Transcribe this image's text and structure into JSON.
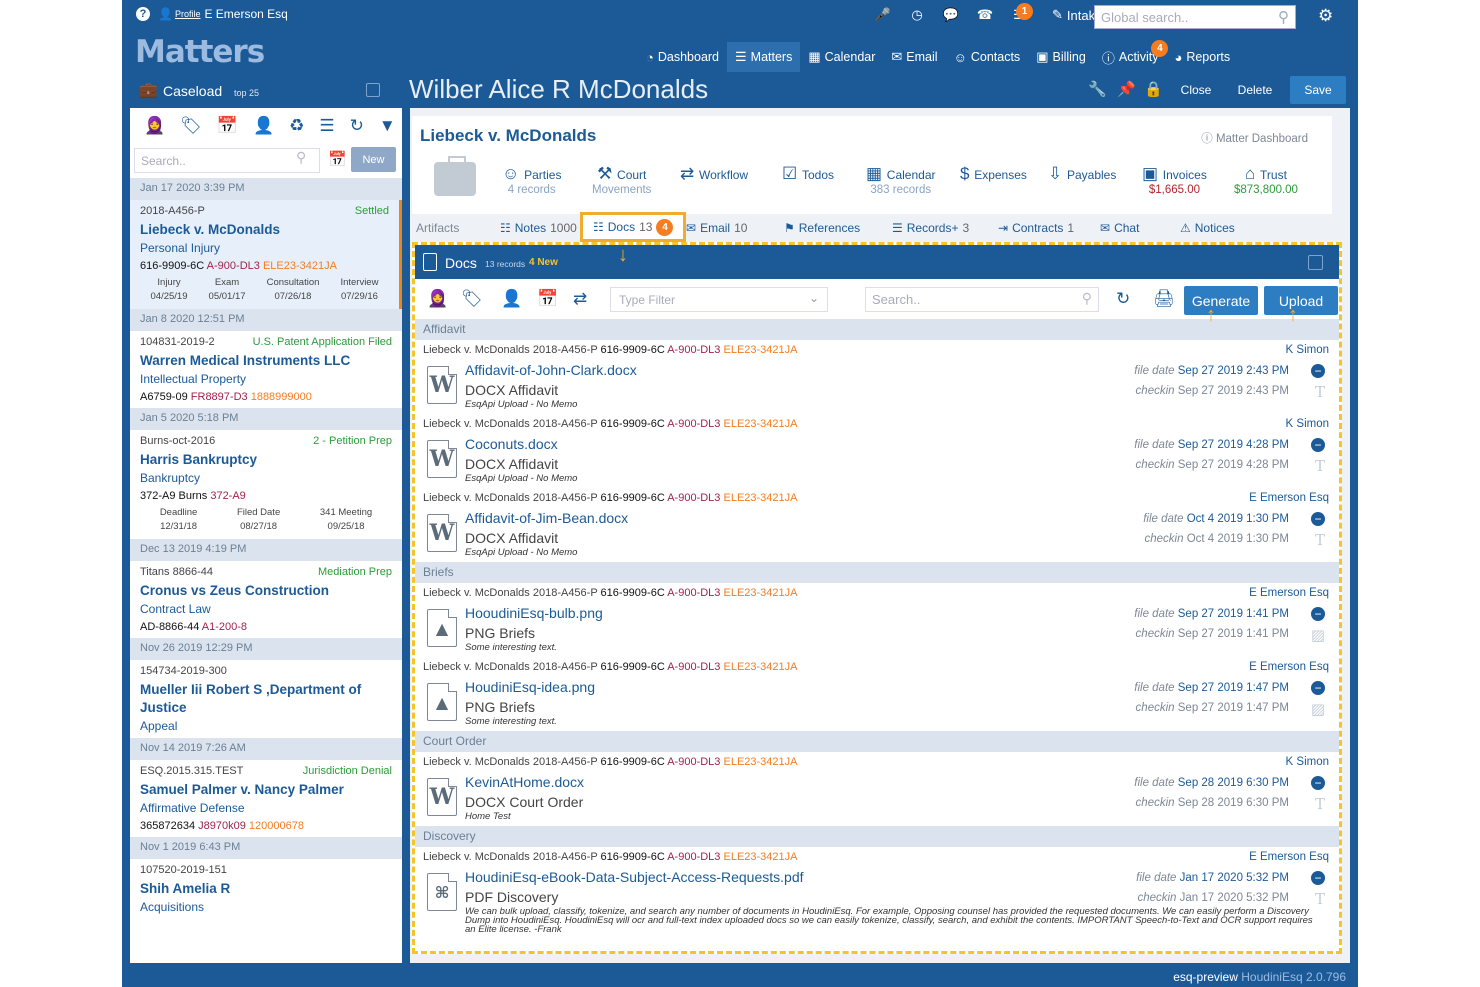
{
  "topbar": {
    "help": "?",
    "profile_label": "Profile",
    "user": "E Emerson Esq",
    "intake": "Intake",
    "search_placeholder": "Global search..",
    "notif_badge": "1"
  },
  "logo": "Matters",
  "nav": [
    {
      "label": "Dashboard",
      "icon": "dashboard-icon"
    },
    {
      "label": "Matters",
      "icon": "matters-icon"
    },
    {
      "label": "Calendar",
      "icon": "calendar-icon"
    },
    {
      "label": "Email",
      "icon": "email-icon"
    },
    {
      "label": "Contacts",
      "icon": "contacts-icon"
    },
    {
      "label": "Billing",
      "icon": "billing-icon"
    },
    {
      "label": "Activity",
      "icon": "activity-icon",
      "badge": "4"
    },
    {
      "label": "Reports",
      "icon": "reports-icon"
    }
  ],
  "caseload": {
    "title": "Caseload",
    "top": "top 25",
    "search_placeholder": "Search..",
    "new": "New"
  },
  "matter_title": "Wilber Alice R McDonalds",
  "actions": {
    "close": "Close",
    "delete": "Delete",
    "save": "Save"
  },
  "cases": [
    {
      "day": "Jan 17 2020 3:39 PM",
      "id": "2018-A456-P",
      "status": "Settled",
      "name": "Liebeck v. McDonalds",
      "type": "Personal Injury",
      "ids": [
        "616-9909-6C",
        "A-900-DL3",
        "ELE23-3421JA"
      ],
      "dates": [
        {
          "l": "Injury",
          "v": "04/25/19"
        },
        {
          "l": "Exam",
          "v": "05/01/17"
        },
        {
          "l": "Consultation",
          "v": "07/26/18"
        },
        {
          "l": "Interview",
          "v": "07/29/16"
        }
      ]
    },
    {
      "day": "Jan 8 2020 12:51 PM",
      "id": "104831-2019-2",
      "status": "U.S. Patent Application Filed",
      "name": "Warren Medical Instruments LLC",
      "type": "Intellectual Property",
      "ids": [
        "A6759-09",
        "FR8897-D3",
        "1888999000"
      ]
    },
    {
      "day": "Jan 5 2020 5:18 PM",
      "id": "Burns-oct-2016",
      "status": "2 - Petition Prep",
      "name": "Harris Bankruptcy",
      "type": "Bankruptcy",
      "ids": [
        "372-A9 Burns",
        "372-A9",
        ""
      ],
      "dates": [
        {
          "l": "Deadline",
          "v": "12/31/18"
        },
        {
          "l": "Filed Date",
          "v": "08/27/18"
        },
        {
          "l": "341 Meeting",
          "v": "09/25/18"
        }
      ]
    },
    {
      "day": "Dec 13 2019 4:19 PM",
      "id": "Titans 8866-44",
      "status": "Mediation Prep",
      "name": "Cronus vs Zeus Construction",
      "type": "Contract Law",
      "ids": [
        "AD-8866-44",
        "A1-200-8",
        ""
      ]
    },
    {
      "day": "Nov 26 2019 12:29 PM",
      "id": "154734-2019-300",
      "status": "",
      "name": "Mueller Iii Robert S ,Department of Justice",
      "type": "Appeal",
      "ids": [
        "",
        "",
        ""
      ]
    },
    {
      "day": "Nov 14 2019 7:26 AM",
      "id": "ESQ.2015.315.TEST",
      "status": "Jurisdiction Denial",
      "name": "Samuel Palmer v. Nancy Palmer",
      "type": "Affirmative Defense",
      "ids": [
        "365872634",
        "J8970k09",
        "120000678"
      ]
    },
    {
      "day": "Nov 1 2019 6:43 PM",
      "id": "107520-2019-151",
      "status": "",
      "name": "Shih Amelia R",
      "type": "Acquisitions",
      "ids": [
        "",
        "",
        ""
      ]
    }
  ],
  "matter": {
    "title": "Liebeck v. McDonalds",
    "dashboard": "Matter Dashboard",
    "items": [
      {
        "label": "Parties",
        "sub": "4 records"
      },
      {
        "label": "Court",
        "sub": "Movements"
      },
      {
        "label": "Workflow",
        "sub": ""
      },
      {
        "label": "Todos",
        "sub": ""
      },
      {
        "label": "Calendar",
        "sub": "383 records"
      },
      {
        "label": "Expenses",
        "sub": ""
      },
      {
        "label": "Payables",
        "sub": ""
      },
      {
        "label": "Invoices",
        "sub": "$1,665.00"
      },
      {
        "label": "Trust",
        "sub": "$873,800.00"
      }
    ]
  },
  "tabs": [
    {
      "label": "Artifacts",
      "count": ""
    },
    {
      "label": "Notes",
      "count": "1000"
    },
    {
      "label": "Docs",
      "count": "13",
      "badge": "4"
    },
    {
      "label": "Email",
      "count": "10"
    },
    {
      "label": "References",
      "count": ""
    },
    {
      "label": "Records+",
      "count": "3"
    },
    {
      "label": "Contracts",
      "count": "1"
    },
    {
      "label": "Chat",
      "count": ""
    },
    {
      "label": "Notices",
      "count": ""
    }
  ],
  "docs": {
    "title": "Docs",
    "count": "13 records",
    "new": "4 New",
    "type_filter": "Type Filter",
    "search_placeholder": "Search..",
    "generate": "Generate",
    "upload": "Upload",
    "groups": [
      {
        "name": "Affidavit",
        "items": [
          {
            "ref": [
              "Liebeck v. McDonalds 2018-A456-P",
              "616-9909-6C",
              "A-900-DL3",
              "ELE23-3421JA"
            ],
            "owner": "K Simon",
            "file": "Affidavit-of-John-Clark.docx",
            "type": "DOCX Affidavit",
            "memo": "EsqApi Upload - No Memo",
            "filedate": "Sep 27 2019 2:43 PM",
            "checkin": "Sep 27 2019 2:43 PM",
            "icon": "W"
          },
          {
            "ref": [
              "Liebeck v. McDonalds 2018-A456-P",
              "616-9909-6C",
              "A-900-DL3",
              "ELE23-3421JA"
            ],
            "owner": "K Simon",
            "file": "Coconuts.docx",
            "type": "DOCX Affidavit",
            "memo": "EsqApi Upload - No Memo",
            "filedate": "Sep 27 2019 4:28 PM",
            "checkin": "Sep 27 2019 4:28 PM",
            "icon": "W"
          },
          {
            "ref": [
              "Liebeck v. McDonalds 2018-A456-P",
              "616-9909-6C",
              "A-900-DL3",
              "ELE23-3421JA"
            ],
            "owner": "E Emerson Esq",
            "file": "Affidavit-of-Jim-Bean.docx",
            "type": "DOCX Affidavit",
            "memo": "EsqApi Upload - No Memo",
            "filedate": "Oct 4 2019 1:30 PM",
            "checkin": "Oct 4 2019 1:30 PM",
            "icon": "W"
          }
        ]
      },
      {
        "name": "Briefs",
        "items": [
          {
            "ref": [
              "Liebeck v. McDonalds 2018-A456-P",
              "616-9909-6C",
              "A-900-DL3",
              "ELE23-3421JA"
            ],
            "owner": "E Emerson Esq",
            "file": "HooudiniEsq-bulb.png",
            "type": "PNG Briefs",
            "memo": "Some interesting text.",
            "filedate": "Sep 27 2019 1:41 PM",
            "checkin": "Sep 27 2019 1:41 PM",
            "icon": "img"
          },
          {
            "ref": [
              "Liebeck v. McDonalds 2018-A456-P",
              "616-9909-6C",
              "A-900-DL3",
              "ELE23-3421JA"
            ],
            "owner": "E Emerson Esq",
            "file": "HoudiniEsq-idea.png",
            "type": "PNG Briefs",
            "memo": "Some interesting text.",
            "filedate": "Sep 27 2019 1:47 PM",
            "checkin": "Sep 27 2019 1:47 PM",
            "icon": "img"
          }
        ]
      },
      {
        "name": "Court Order",
        "items": [
          {
            "ref": [
              "Liebeck v. McDonalds 2018-A456-P",
              "616-9909-6C",
              "A-900-DL3",
              "ELE23-3421JA"
            ],
            "owner": "K Simon",
            "file": "KevinAtHome.docx",
            "type": "DOCX Court Order",
            "memo": "Home Test",
            "filedate": "Sep 28 2019 6:30 PM",
            "checkin": "Sep 28 2019 6:30 PM",
            "icon": "W"
          }
        ]
      },
      {
        "name": "Discovery",
        "items": [
          {
            "ref": [
              "Liebeck v. McDonalds 2018-A456-P",
              "616-9909-6C",
              "A-900-DL3",
              "ELE23-3421JA"
            ],
            "owner": "E Emerson Esq",
            "file": "HoudiniEsq-eBook-Data-Subject-Access-Requests.pdf",
            "type": "PDF Discovery",
            "memo": "We can bulk upload, classify, tokenize, and search any number of documents in HoudiniEsq. For example, Opposing counsel has provided the requested documents. We can easily perform a Discovery Dump into HoudiniEsq. HoudiniEsq will ocr and full-text index uploaded docs so we can easily tokenize, classify, search, and exhibit the contents. IMPORTANT Speech-to-Text and OCR support requires an Elite license. -Frank",
            "filedate": "Jan 17 2020 5:32 PM",
            "checkin": "Jan 17 2020 5:32 PM",
            "icon": "pdf"
          }
        ]
      }
    ]
  },
  "labels": {
    "file_date": "file date",
    "checkin": "checkin"
  },
  "footer": {
    "env": "esq-preview",
    "version": "HoudiniEsq 2.0.796"
  }
}
